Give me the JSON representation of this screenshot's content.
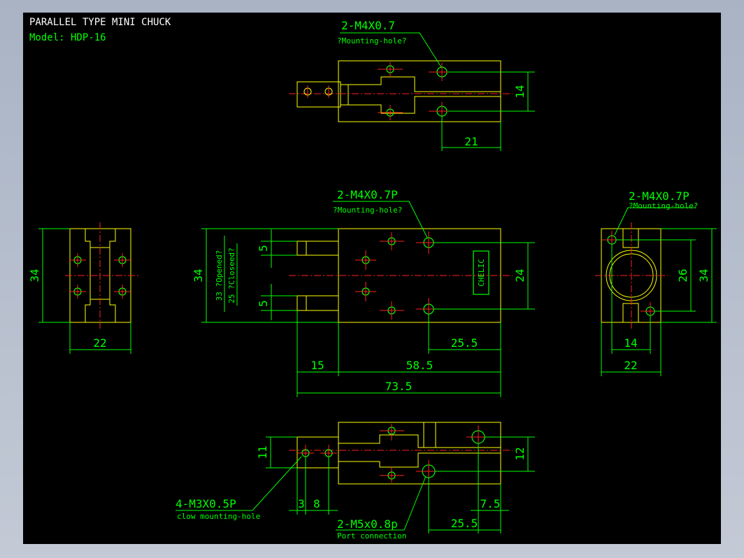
{
  "title": "PARALLEL TYPE MINI CHUCK",
  "model": "Model: HDP-16",
  "views": {
    "top": {
      "callout_spec": "2-M4X0.7",
      "callout_note": "?Mounting-hole?",
      "dim_height": "14",
      "dim_width": "21"
    },
    "left": {
      "dim_height": "34",
      "dim_width": "22"
    },
    "front": {
      "callout_spec": "2-M4X0.7P",
      "callout_note": "?Mounting-hole?",
      "dim_total_height": "34",
      "dim_opened": "33 ?Opened?",
      "dim_closed": "25 ?Closeed?",
      "dim_jaw_upper": "5",
      "dim_jaw_lower": "5",
      "dim_body_height": "24",
      "dim_25_5": "25.5",
      "dim_15": "15",
      "dim_58_5": "58.5",
      "dim_73_5": "73.5",
      "brand": "CHELIC"
    },
    "right": {
      "callout_spec": "2-M4X0.7P",
      "callout_note": "?Mounting-hole?",
      "dim_height": "34",
      "dim_inner": "26",
      "dim_14": "14",
      "dim_22": "22"
    },
    "bottom": {
      "dim_11": "11",
      "dim_12": "12",
      "dim_3": "3",
      "dim_8": "8",
      "dim_7_5": "7.5",
      "dim_25_5": "25.5",
      "claw_spec": "4-M3X0.5P",
      "claw_note": "clow mounting-hole",
      "port_spec": "2-M5x0.8p",
      "port_note": "Port connection"
    }
  }
}
